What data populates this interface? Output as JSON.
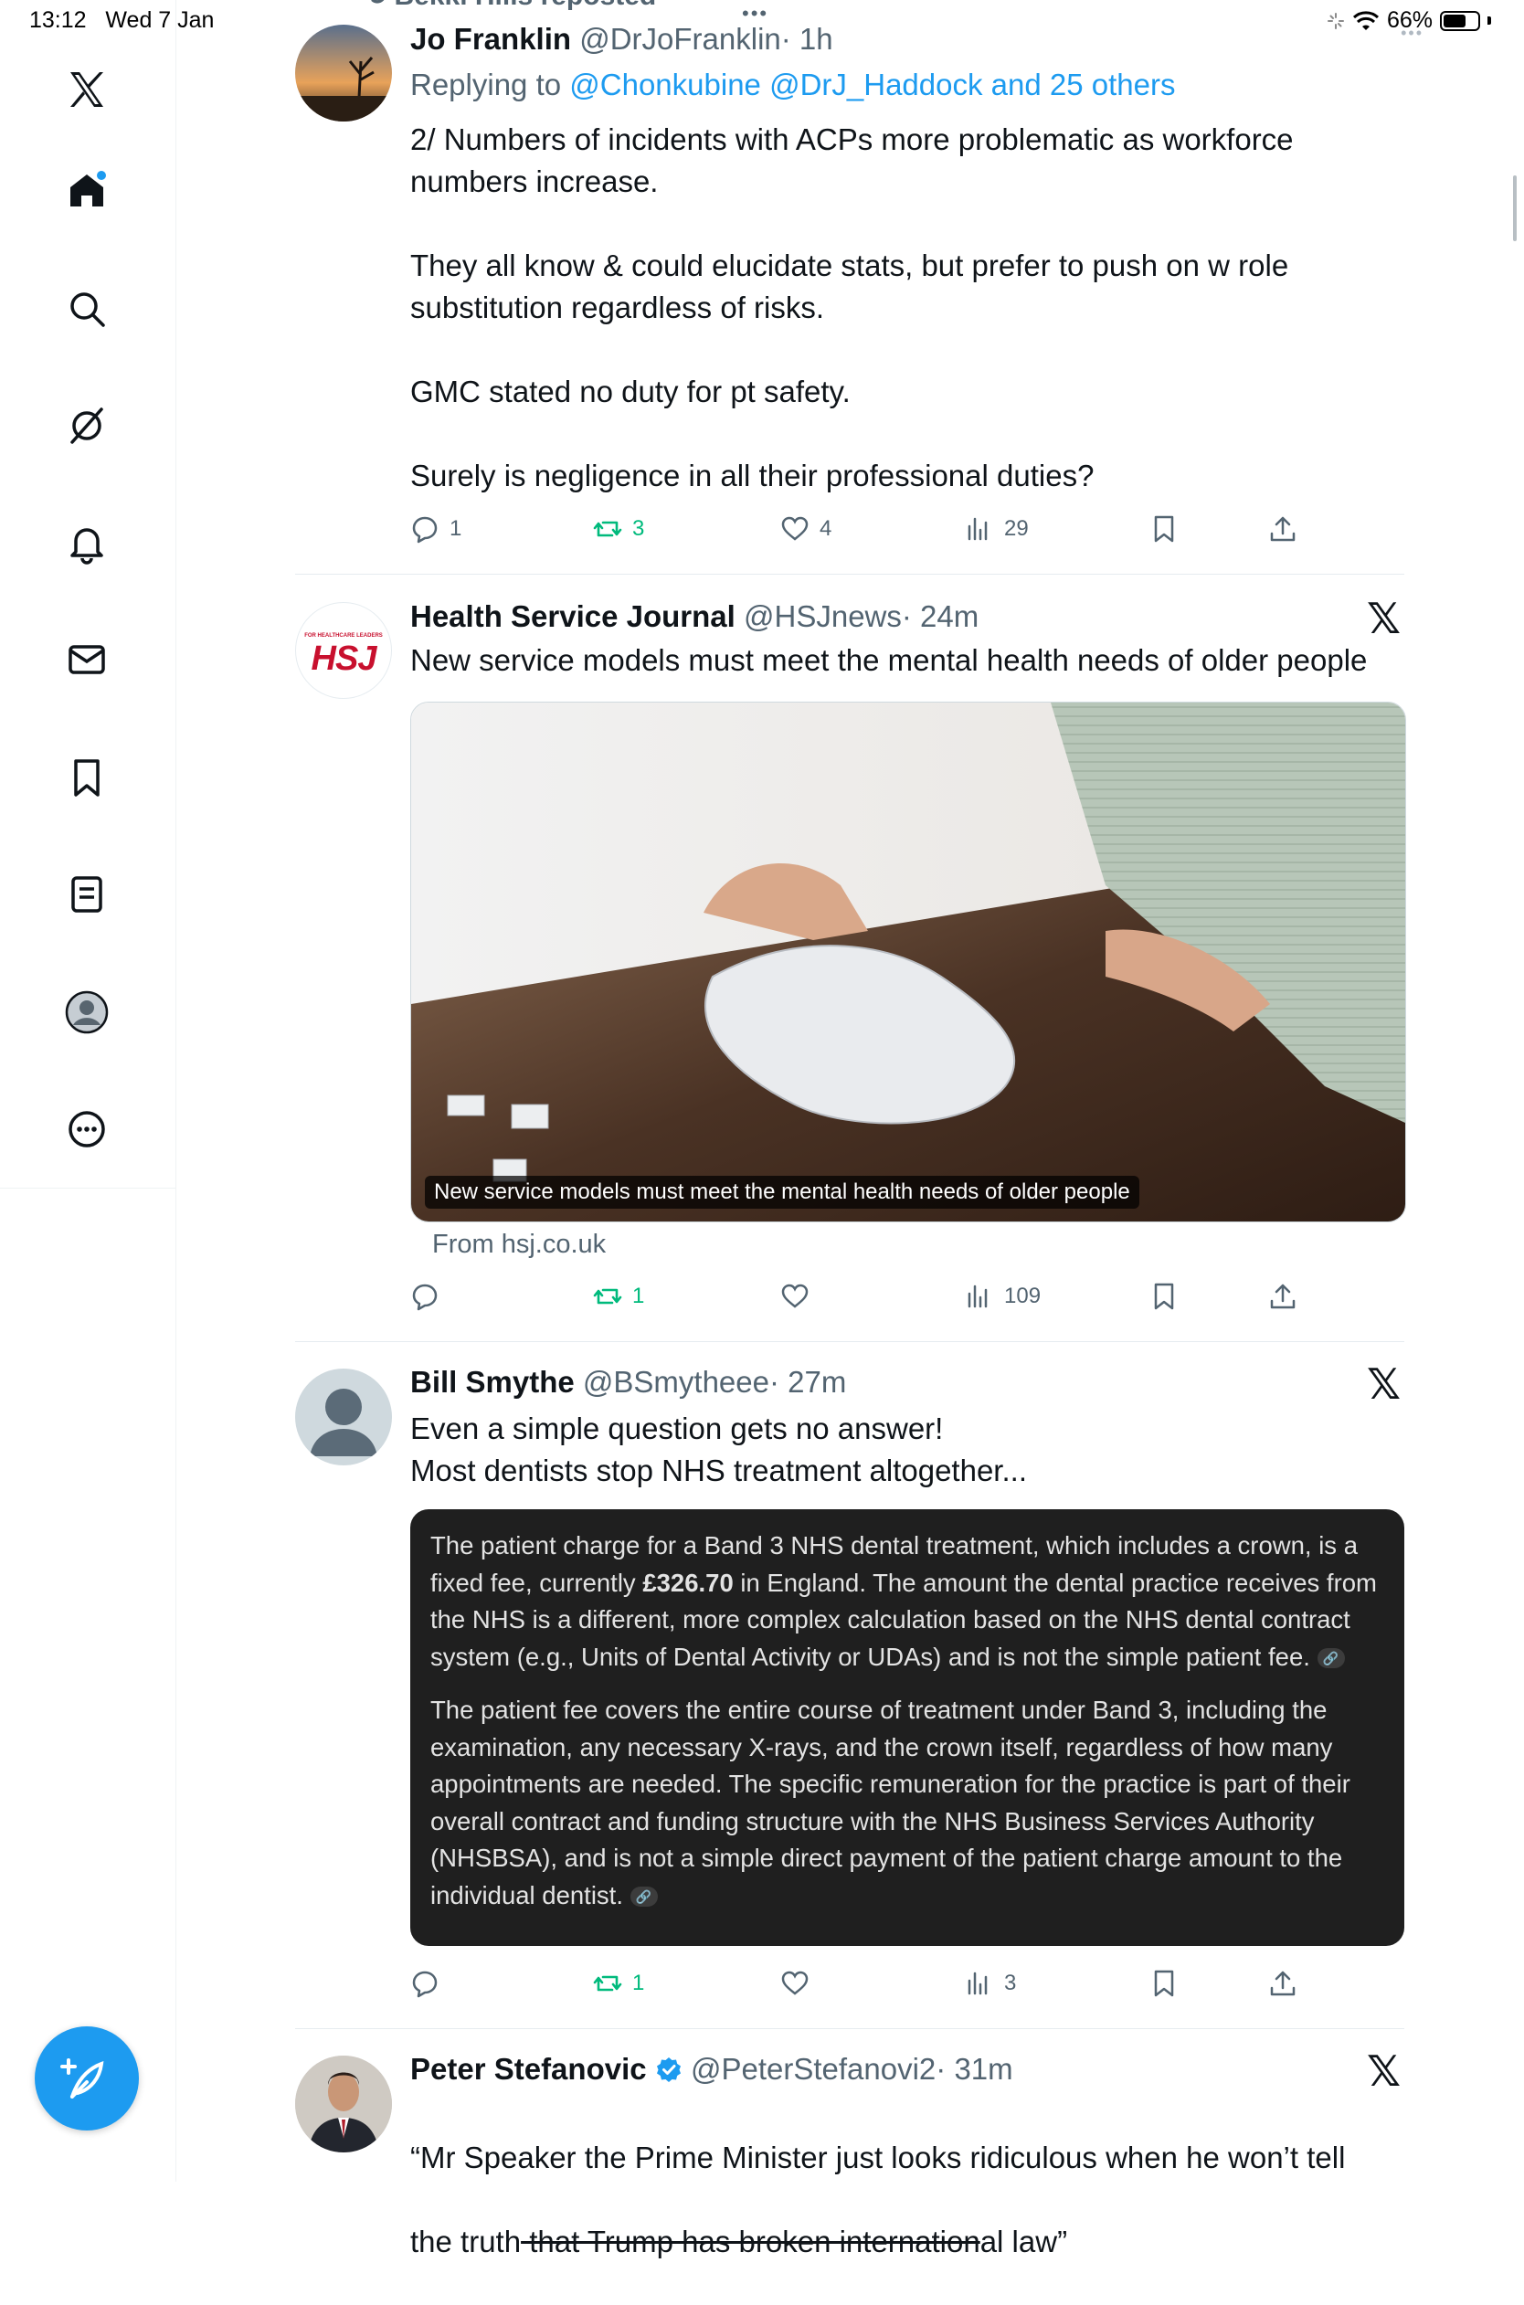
{
  "status_bar": {
    "time": "13:12",
    "date": "Wed 7 Jan",
    "battery": "66%",
    "battery_level": 0.66
  },
  "repost_banner": "Bekki Hills reposted",
  "sidebar": {
    "items": [
      {
        "icon": "x-logo-icon"
      },
      {
        "icon": "home-icon"
      },
      {
        "icon": "search-icon"
      },
      {
        "icon": "grok-icon"
      },
      {
        "icon": "notifications-bell-icon"
      },
      {
        "icon": "messages-envelope-icon"
      },
      {
        "icon": "bookmark-icon"
      },
      {
        "icon": "lists-icon"
      },
      {
        "icon": "profile-avatar-icon"
      },
      {
        "icon": "more-circle-icon"
      }
    ],
    "compose_icon": "compose-feather-plus-icon"
  },
  "tweets": [
    {
      "name": "Jo Franklin",
      "handle": "@DrJoFranklin",
      "time": "· 1h",
      "replying_prefix": "Replying to ",
      "replying_to": "@Chonkubine @DrJ_Haddock and 25 others",
      "text": "2/ Numbers of incidents with ACPs more problematic as workforce numbers increase.\n\nThey all know & could elucidate  stats, but prefer to push on w role substitution regardless of  risks.\n\nGMC stated no duty for pt safety.\n\nSurely is negligence in all their professional duties?",
      "replies": "1",
      "reposts": "3",
      "likes": "4",
      "views": "29"
    },
    {
      "name": "Health Service Journal",
      "handle": "@HSJnews",
      "time": "· 24m",
      "avatar_text": "HSJ",
      "avatar_subtext": "FOR HEALTHCARE LEADERS",
      "text": "New service models must meet the mental health needs of older people",
      "card_caption": "New service models must meet the mental health needs of older people",
      "card_from": "From hsj.co.uk",
      "replies": "",
      "reposts": "1",
      "likes": "",
      "views": "109"
    },
    {
      "name": "Bill Smythe",
      "handle": "@BSmytheee",
      "time": "· 27m",
      "text": "Even a simple question gets no answer!\nMost dentists stop NHS treatment altogether...",
      "quote_p1_a": "The patient charge for a Band 3 NHS dental treatment, which includes a crown, is a fixed fee, currently ",
      "quote_p1_bold": "£326.70",
      "quote_p1_b": " in England. The amount the dental practice receives from the NHS is a different, more complex calculation based on the NHS dental contract system (e.g., Units of Dental Activity or UDAs) and is not the simple patient fee.",
      "quote_p2": "The patient fee covers the entire course of treatment under Band 3, including the examination, any necessary X-rays, and the crown itself, regardless of how many appointments are needed. The specific remuneration for the practice is part of their overall contract and funding structure with the NHS Business Services Authority (NHSBSA), and is not a simple direct payment of the patient charge amount to the individual dentist.",
      "replies": "",
      "reposts": "1",
      "likes": "",
      "views": "3"
    },
    {
      "name": "Peter Stefanovic",
      "handle": "@PeterStefanovi2",
      "time": "· 31m",
      "text_line1": "“Mr Speaker the Prime Minister just looks ridiculous when he won’t tell",
      "text_line2_a": "the truth",
      "text_line2_strike": " that Trump has broken internation",
      "text_line2_b": "al law”"
    }
  ]
}
